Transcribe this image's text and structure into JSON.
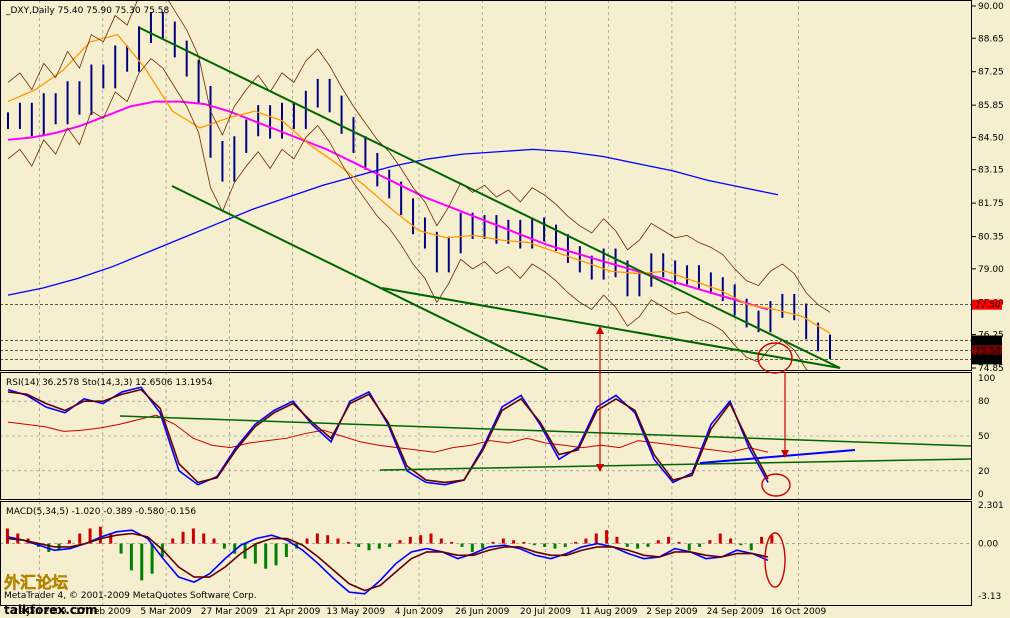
{
  "chart_data": [
    {
      "type": "line",
      "title": "_DXY,Daily  75.40 75.90 75.30 75.58",
      "symbol": "_DXY",
      "timeframe": "Daily",
      "ohlc": {
        "open": 75.4,
        "high": 75.9,
        "low": 75.3,
        "close": 75.58
      },
      "x_ticks": [
        "29 Jan 2009",
        "17 Feb 2009",
        "5 Mar 2009",
        "27 Mar 2009",
        "21 Apr 2009",
        "13 May 2009",
        "4 Jun 2009",
        "26 Jun 2009",
        "20 Jul 2009",
        "11 Aug 2009",
        "2 Sep 2009",
        "24 Sep 2009",
        "16 Oct 2009"
      ],
      "y_ticks": [
        "90.00",
        "88.65",
        "87.25",
        "85.85",
        "84.50",
        "83.15",
        "81.75",
        "80.35",
        "79.00",
        "77.60",
        "76.25",
        "74.85"
      ],
      "ylim": [
        74.85,
        90.0
      ],
      "price_labels": [
        {
          "text": "77.50",
          "value": 77.5,
          "bg": "#ff0000",
          "fg": "#000000"
        },
        {
          "text": "76.00",
          "value": 76.0,
          "bg": "#000000",
          "fg": "#ffffff"
        },
        {
          "text": "75.58",
          "value": 75.58,
          "bg": "#800000",
          "fg": "#ffffff"
        },
        {
          "text": "75.21",
          "value": 75.21,
          "bg": "#000000",
          "fg": "#ffffff"
        }
      ],
      "series": [
        {
          "values": [
            85.2,
            85.6,
            84.9,
            86.0,
            85.4,
            86.5,
            85.8,
            87.2,
            86.9,
            88.0,
            87.6,
            88.8,
            89.4,
            89.0,
            88.2,
            87.4,
            86.3,
            84.0,
            83.0,
            84.2,
            84.9,
            85.5,
            84.8,
            85.6,
            85.2,
            86.1,
            86.6,
            85.9,
            85.0,
            84.2,
            83.5,
            82.8,
            82.3,
            81.6,
            80.8,
            80.2,
            79.2,
            80.0,
            81.0,
            80.6,
            80.9,
            80.4,
            80.7,
            80.2,
            80.8,
            80.5,
            80.1,
            79.6,
            79.2,
            78.9,
            79.5,
            79.0,
            78.2,
            78.6,
            79.3,
            79.0,
            78.7,
            78.8,
            78.5,
            78.3,
            78.0,
            77.4,
            76.9,
            76.7,
            77.3,
            77.6,
            77.2,
            76.4,
            75.9,
            75.58
          ]
        },
        {
          "color": "#ff00ff",
          "values": [
            84.4,
            84.5,
            84.7,
            85.0,
            85.4,
            85.8,
            86.0,
            86.0,
            85.9,
            85.6,
            85.2,
            84.8,
            84.4,
            84.0,
            83.5,
            83.0,
            82.5,
            82.0,
            81.6,
            81.2,
            80.8,
            80.4,
            80.0,
            79.7,
            79.4,
            79.1,
            78.8,
            78.5,
            78.2,
            77.9,
            77.6,
            77.3
          ]
        },
        {
          "color": "#0000ff",
          "values": [
            77.9,
            78.2,
            78.6,
            79.1,
            79.7,
            80.3,
            80.9,
            81.5,
            82.0,
            82.5,
            82.9,
            83.3,
            83.6,
            83.8,
            83.9,
            84.0,
            83.9,
            83.7,
            83.4,
            83.1,
            82.7,
            82.4,
            82.1
          ]
        },
        {
          "color": "#ff9900",
          "values": [
            86.0,
            86.5,
            87.3,
            88.5,
            88.8,
            87.4,
            85.6,
            84.9,
            85.3,
            85.6,
            85.2,
            84.2,
            83.4,
            82.5,
            81.5,
            80.6,
            80.3,
            80.4,
            80.2,
            80.1,
            79.7,
            79.3,
            78.9,
            78.8,
            78.9,
            78.5,
            78.1,
            77.5,
            77.3,
            77.0,
            76.3
          ]
        }
      ],
      "trend_lines": [
        {
          "color": "#006600",
          "points": [
            [
              85.2,
              89.4
            ],
            [
              86.0,
              75.0
            ]
          ]
        },
        {
          "color": "#006600",
          "points": [
            [
              83.0,
              83.0
            ],
            [
              74.85,
              74.85
            ]
          ]
        },
        {
          "color": "#006600",
          "points": [
            [
              78.1,
              78.1
            ],
            [
              75.0,
              75.0
            ]
          ]
        }
      ]
    },
    {
      "type": "line",
      "title": "RSI(14) 36.2578  Sto(14,3,3) 12.6506 13.1954",
      "rsi": 36.2578,
      "stochastic": {
        "main": 12.6506,
        "signal": 13.1954
      },
      "y_ticks": [
        "100",
        "80",
        "50",
        "20",
        "0"
      ],
      "ylim": [
        0,
        100
      ],
      "series": [
        {
          "color": "#cc0000",
          "values": [
            62,
            60,
            58,
            54,
            55,
            57,
            60,
            64,
            68,
            60,
            48,
            42,
            40,
            44,
            46,
            48,
            52,
            55,
            50,
            45,
            42,
            40,
            38,
            36,
            40,
            42,
            46,
            44,
            48,
            44,
            42,
            40,
            42,
            40,
            46,
            44,
            42,
            40,
            38,
            36,
            40,
            36
          ]
        },
        {
          "color": "#0000ff",
          "values": [
            90,
            85,
            75,
            70,
            82,
            78,
            88,
            92,
            70,
            20,
            8,
            15,
            40,
            60,
            72,
            80,
            60,
            45,
            80,
            88,
            60,
            20,
            10,
            8,
            12,
            40,
            75,
            85,
            60,
            30,
            40,
            75,
            85,
            70,
            30,
            10,
            18,
            60,
            80,
            40,
            10
          ]
        },
        {
          "color": "#660000",
          "values": [
            88,
            86,
            78,
            72,
            80,
            80,
            86,
            90,
            74,
            26,
            10,
            14,
            38,
            58,
            70,
            78,
            62,
            48,
            78,
            86,
            62,
            24,
            12,
            10,
            12,
            38,
            72,
            82,
            62,
            34,
            38,
            72,
            82,
            72,
            34,
            12,
            16,
            56,
            78,
            44,
            13
          ]
        }
      ]
    },
    {
      "type": "bar",
      "title": "MACD(5,34,5) -1.020 -0.389 -0.580 -0.156",
      "macd": [
        -1.02,
        -0.389,
        -0.58,
        -0.156
      ],
      "y_ticks": [
        "2.301",
        "0.00",
        "-3.13"
      ],
      "ylim": [
        -3.13,
        2.301
      ],
      "histogram": [
        0.9,
        0.6,
        0.3,
        -0.2,
        -0.5,
        -0.4,
        0.2,
        0.6,
        0.9,
        1.0,
        0.6,
        -0.6,
        -1.6,
        -2.2,
        -1.8,
        -0.8,
        0.3,
        0.7,
        0.9,
        0.6,
        0.3,
        -0.3,
        -0.6,
        -0.9,
        -1.2,
        -1.5,
        -1.3,
        -0.8,
        -0.3,
        0.3,
        0.6,
        0.5,
        0.3,
        0.1,
        -0.2,
        -0.4,
        -0.3,
        -0.2,
        0.2,
        0.4,
        0.5,
        0.6,
        0.3,
        0.1,
        -0.2,
        -0.5,
        -0.3,
        0.1,
        0.3,
        0.2,
        0.1,
        -0.1,
        -0.2,
        -0.3,
        -0.2,
        0.1,
        0.3,
        0.6,
        0.8,
        0.4,
        -0.2,
        -0.3,
        -0.2,
        0.2,
        0.4,
        0.1,
        -0.4,
        -0.2,
        0.2,
        0.6,
        0.3,
        -0.1,
        -0.4,
        0.4,
        0.5
      ],
      "series": [
        {
          "color": "#0000ff",
          "values": [
            0.4,
            0.2,
            -0.1,
            -0.4,
            -0.3,
            0.0,
            0.4,
            0.7,
            0.8,
            0.3,
            -0.9,
            -2.0,
            -2.3,
            -1.8,
            -0.9,
            -0.1,
            0.3,
            0.5,
            0.2,
            -0.4,
            -1.2,
            -2.1,
            -2.9,
            -3.0,
            -2.2,
            -1.2,
            -0.5,
            -0.3,
            -0.5,
            -0.9,
            -0.6,
            -0.2,
            -0.1,
            -0.3,
            -0.7,
            -0.9,
            -0.6,
            -0.2,
            0.0,
            -0.2,
            -0.6,
            -0.9,
            -0.8,
            -0.3,
            -0.5,
            -0.9,
            -0.8,
            -0.4,
            -0.6,
            -1.0
          ]
        },
        {
          "color": "#660000",
          "values": [
            0.3,
            0.2,
            0.0,
            -0.2,
            -0.2,
            0.0,
            0.3,
            0.5,
            0.6,
            0.4,
            -0.4,
            -1.4,
            -2.0,
            -2.0,
            -1.4,
            -0.6,
            0.0,
            0.3,
            0.3,
            -0.1,
            -0.8,
            -1.6,
            -2.4,
            -2.8,
            -2.5,
            -1.7,
            -0.9,
            -0.5,
            -0.5,
            -0.7,
            -0.7,
            -0.4,
            -0.2,
            -0.2,
            -0.5,
            -0.7,
            -0.7,
            -0.4,
            -0.2,
            -0.2,
            -0.4,
            -0.7,
            -0.8,
            -0.5,
            -0.5,
            -0.7,
            -0.8,
            -0.6,
            -0.6,
            -0.8
          ]
        }
      ]
    }
  ],
  "watermark_text": "MetaTrader 4, © 2001-2009 MetaQuotes Software Corp.",
  "logo": {
    "main": "外汇论坛",
    "site": "talkforex.com"
  }
}
